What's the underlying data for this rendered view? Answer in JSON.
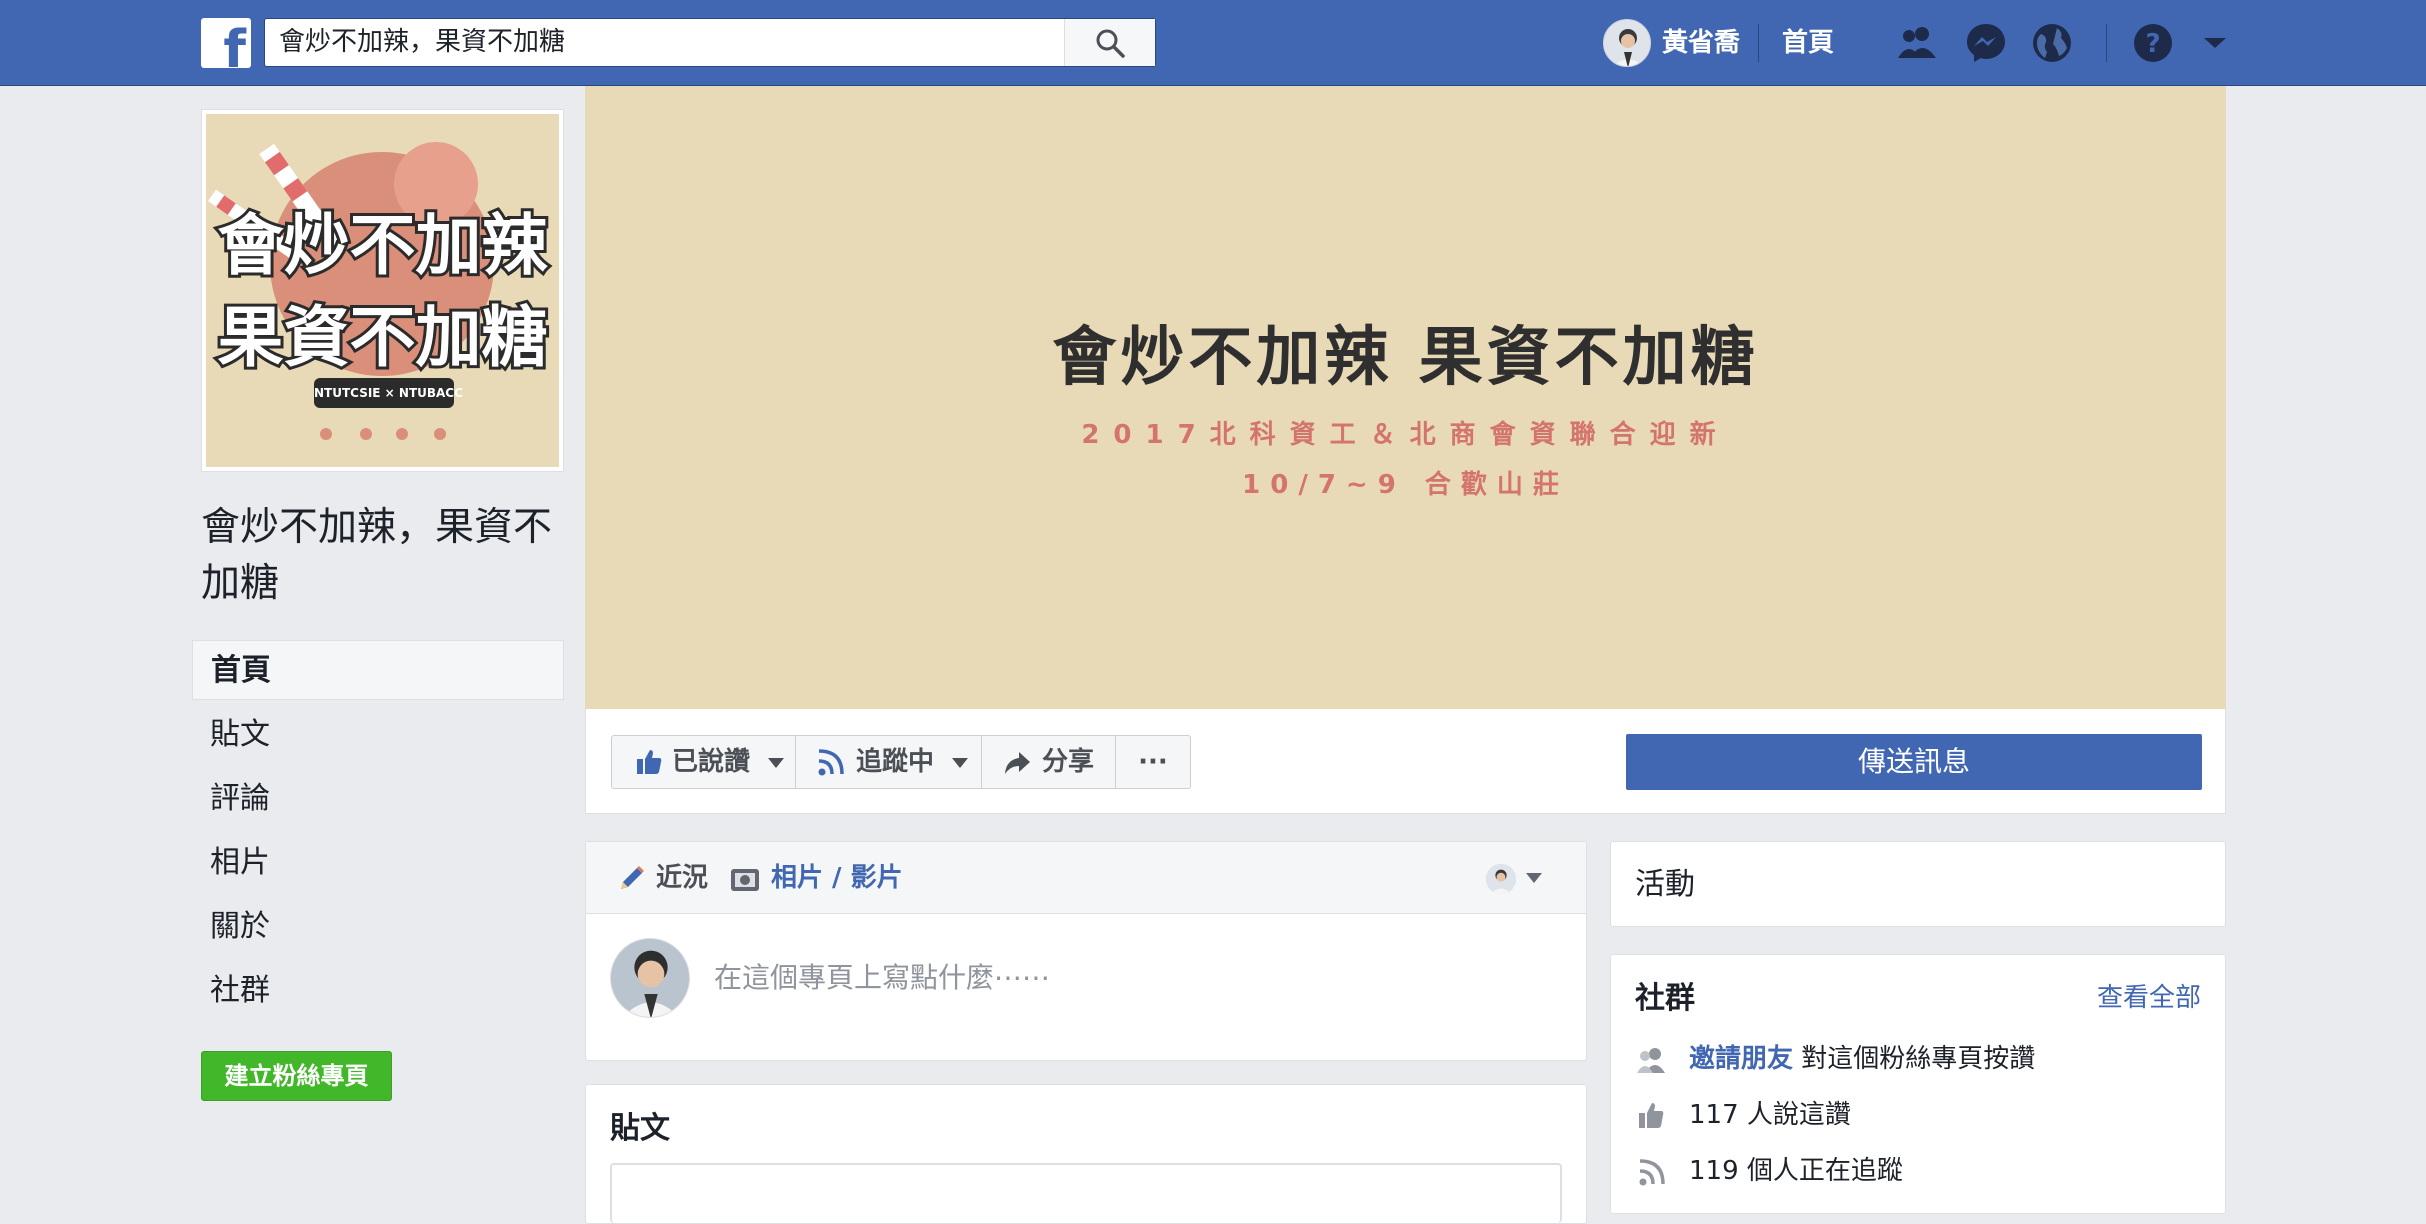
{
  "search": {
    "value": "會炒不加辣，果資不加糖"
  },
  "topbar": {
    "user_name": "黃省喬",
    "home_label": "首頁",
    "icons": [
      "friends-icon",
      "messenger-icon",
      "globe-icon",
      "help-icon",
      "dropdown-icon"
    ]
  },
  "page": {
    "name": "會炒不加辣，果資不加糖",
    "profile_logo": {
      "line1": "會炒不加辣",
      "line2": "果資不加糖",
      "tag": "NTUTCSIE × NTUBACC"
    }
  },
  "left_nav": {
    "items": [
      {
        "label": "首頁"
      },
      {
        "label": "貼文"
      },
      {
        "label": "評論"
      },
      {
        "label": "相片"
      },
      {
        "label": "關於"
      },
      {
        "label": "社群"
      }
    ],
    "create_page_label": "建立粉絲專頁"
  },
  "cover": {
    "title": "會炒不加辣 果資不加糖",
    "subtitle": "2017北科資工＆北商會資聯合迎新",
    "date": "10/7~9 合歡山莊"
  },
  "actions": {
    "liked_label": "已說讚",
    "following_label": "追蹤中",
    "share_label": "分享",
    "more_label": "···",
    "send_message_label": "傳送訊息"
  },
  "composer": {
    "status_tab": "近況",
    "photo_tab": "相片 / 影片",
    "placeholder": "在這個專頁上寫點什麼⋯⋯"
  },
  "posts": {
    "title": "貼文"
  },
  "events": {
    "title": "活動"
  },
  "community": {
    "title": "社群",
    "see_all": "查看全部",
    "invite_link": "邀請朋友",
    "invite_text": "對這個粉絲專頁按讚",
    "likes_text": "117 人說這讚",
    "followers_text": "119 個人正在追蹤"
  },
  "colors": {
    "brand_blue": "#4267b2",
    "cover_bg": "#e8d9b7",
    "cover_accent": "#d3756d",
    "create_green": "#42b72a"
  }
}
